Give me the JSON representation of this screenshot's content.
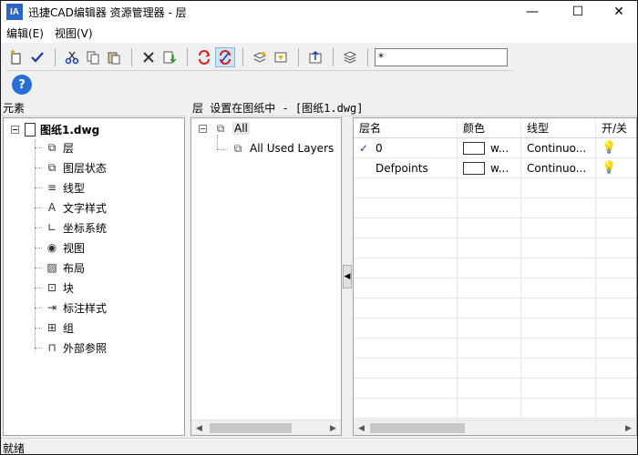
{
  "window": {
    "logo": "IA",
    "title": "迅捷CAD编辑器 资源管理器 - 层",
    "minimize": "—",
    "maximize": "☐",
    "close": "✕"
  },
  "menu": [
    {
      "label": "编辑(E)"
    },
    {
      "label": "视图(V)"
    }
  ],
  "toolbar": {
    "filter_value": "*",
    "help_label": "?"
  },
  "left_panel": {
    "header": "元素",
    "root": "图纸1.dwg",
    "items": [
      {
        "label": "层",
        "icon": "layers-icon",
        "glyph": "⧉"
      },
      {
        "label": "图层状态",
        "icon": "layer-state-icon",
        "glyph": "⧉"
      },
      {
        "label": "线型",
        "icon": "linetype-icon",
        "glyph": "≡"
      },
      {
        "label": "文字样式",
        "icon": "text-style-icon",
        "glyph": "A"
      },
      {
        "label": "坐标系统",
        "icon": "ucs-icon",
        "glyph": "∟"
      },
      {
        "label": "视图",
        "icon": "eye-icon",
        "glyph": "◉"
      },
      {
        "label": "布局",
        "icon": "layout-icon",
        "glyph": "▨"
      },
      {
        "label": "块",
        "icon": "block-icon",
        "glyph": "⊡"
      },
      {
        "label": "标注样式",
        "icon": "dimension-style-icon",
        "glyph": "⇥"
      },
      {
        "label": "组",
        "icon": "group-icon",
        "glyph": "⊞"
      },
      {
        "label": "外部参照",
        "icon": "xref-icon",
        "glyph": "⊓"
      }
    ]
  },
  "middle": {
    "header": "层 设置在图纸中 - [图纸1.dwg]",
    "tree": {
      "root": "All",
      "child": "All Used Layers"
    }
  },
  "grid": {
    "columns": [
      "层名",
      "颜色",
      "线型",
      "开/关"
    ],
    "rows": [
      {
        "current": "✓",
        "name": "0",
        "color": "w...",
        "linetype": "Continuo...",
        "on": "💡"
      },
      {
        "current": "",
        "name": "Defpoints",
        "color": "w...",
        "linetype": "Continuo...",
        "on": "💡"
      }
    ]
  },
  "status": "就绪",
  "colors": {
    "accent": "#2a66c8",
    "help": "#2a6fd6",
    "active_button": "#cde3f7"
  }
}
